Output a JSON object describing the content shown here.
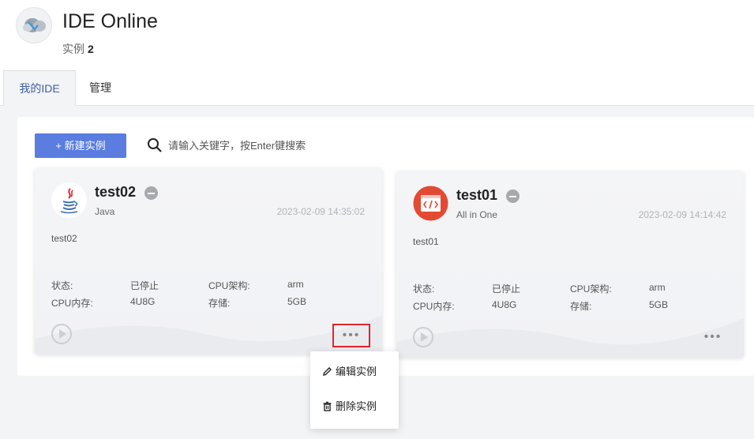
{
  "header": {
    "title": "IDE Online",
    "instance_label": "实例",
    "instance_count": "2"
  },
  "tabs": [
    {
      "label": "我的IDE",
      "active": true
    },
    {
      "label": "管理",
      "active": false
    }
  ],
  "toolbar": {
    "new_button": "+ 新建实例",
    "search_placeholder": "请输入关键字，按Enter键搜索"
  },
  "colors": {
    "accent": "#5a7ddf",
    "active_tab_text": "#3f5ea8",
    "highlight_border": "#e0262c"
  },
  "cards": [
    {
      "name": "test02",
      "icon": "java-icon",
      "type": "Java",
      "time": "2023-02-09 14:35:02",
      "desc": "test02",
      "status_label": "状态:",
      "status_value": "已停止",
      "arch_label": "CPU架构:",
      "arch_value": "arm",
      "cpu_label": "CPU内存:",
      "cpu_value": "4U8G",
      "storage_label": "存储:",
      "storage_value": "5GB",
      "more": "•••"
    },
    {
      "name": "test01",
      "icon": "code-icon",
      "type": "All in One",
      "time": "2023-02-09 14:14:42",
      "desc": "test01",
      "status_label": "状态:",
      "status_value": "已停止",
      "arch_label": "CPU架构:",
      "arch_value": "arm",
      "cpu_label": "CPU内存:",
      "cpu_value": "4U8G",
      "storage_label": "存储:",
      "storage_value": "5GB",
      "more": "•••"
    }
  ],
  "context_menu": {
    "edit": "编辑实例",
    "delete": "删除实例"
  }
}
